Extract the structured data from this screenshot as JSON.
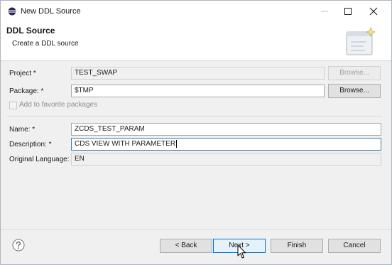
{
  "window": {
    "title": "New DDL Source",
    "icon": "eclipse-icon",
    "controls": [
      "minimize-icon",
      "maximize-icon",
      "close-icon"
    ]
  },
  "header": {
    "title": "DDL Source",
    "subtitle": "Create a DDL source",
    "icon": "wizard-banner-icon"
  },
  "form": {
    "project": {
      "label": "Project *",
      "value": "TEST_SWAP",
      "browse_label": "Browse...",
      "browse_enabled": false
    },
    "package": {
      "label": "Package: *",
      "value": "$TMP",
      "browse_label": "Browse...",
      "browse_enabled": true
    },
    "favorites": {
      "label": "Add to favorite packages",
      "checked": false,
      "enabled": false
    },
    "name": {
      "label": "Name: *",
      "value": "ZCDS_TEST_PARAM"
    },
    "description": {
      "label": "Description: *",
      "value": "CDS VIEW WITH PARAMETER"
    },
    "original_language": {
      "label": "Original Language:",
      "value": "EN"
    }
  },
  "footer": {
    "help_icon": "help-icon",
    "back_label": "< Back",
    "next_label": "Next >",
    "finish_label": "Finish",
    "cancel_label": "Cancel"
  },
  "colors": {
    "accent": "#0078d7",
    "focus_border": "#3c7fb1",
    "dialog_bg": "#f0f0f0"
  }
}
